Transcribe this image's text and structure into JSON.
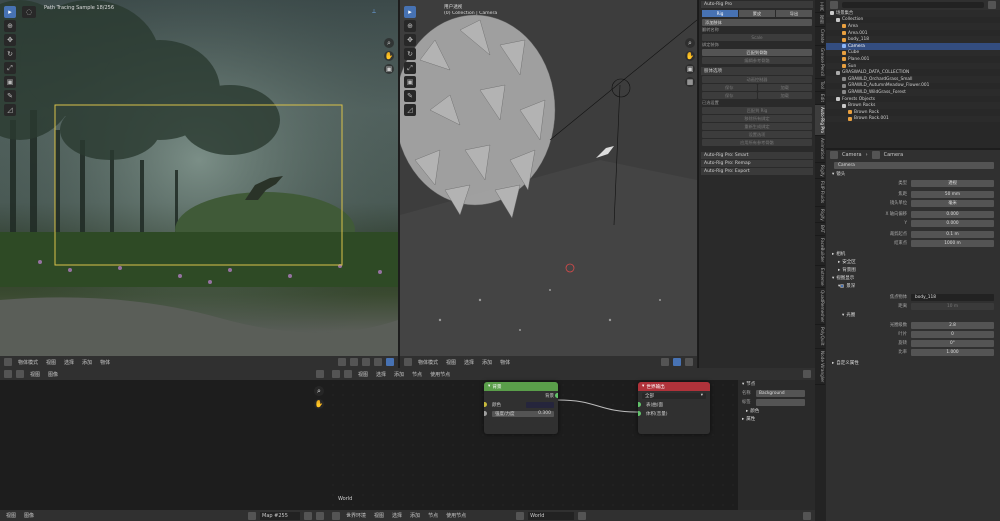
{
  "left_viewport": {
    "title": "Path Tracing Sample 18/256",
    "header": [
      "物体模式",
      "视图",
      "选择",
      "添加",
      "物体"
    ]
  },
  "right_viewport": {
    "title_line1": "用户透视",
    "title_line2": "(0) Collection | Camera",
    "header": [
      "物体模式",
      "视图",
      "选择",
      "添加",
      "物体"
    ]
  },
  "npanel": {
    "title": "Auto-Rig Pro",
    "tabs": [
      "Rig",
      "蒙皮",
      "导出"
    ],
    "add_limb": "添加肢体",
    "rows_top": [
      "翻转名称",
      "Scale"
    ],
    "label_rig_type": "绑定装饰",
    "btn_ref_bones": "匹配到骨骼",
    "btn_edit_ref": "编辑参考骨骼",
    "section_limb": "肢体选项",
    "sect2": "动画控制器",
    "sect3": "已选设置",
    "btns_mid": [
      "保存",
      "加载",
      "保存",
      "加载",
      "匹配到 Rig"
    ],
    "btns_low": [
      "移除所有绑定",
      "重新生成绑定",
      "设置选项",
      "应用所有参考骨骼"
    ],
    "subpanels": [
      "Auto-Rig Pro: Smart",
      "Auto-Rig Pro: Remap",
      "Auto-Rig Pro: Export"
    ]
  },
  "vtabs": [
    "工具",
    "视图",
    "Create",
    "Grease Pencil",
    "Tool",
    "Edit",
    "Auto-Rig Pro",
    "Animation",
    "Rigify",
    "FLIP Fluids",
    "Rigify",
    "BAT",
    "FaceBuilder",
    "Extreme",
    "QuadRemesher",
    "PolyQuilt",
    "Node Wrangler"
  ],
  "outliner": {
    "title": "场景集合",
    "rows": [
      {
        "name": "Collection",
        "indent": 1,
        "color": "#c8c8c8"
      },
      {
        "name": "Area",
        "indent": 2,
        "color": "#e8a040"
      },
      {
        "name": "Area.001",
        "indent": 2,
        "color": "#e8a040"
      },
      {
        "name": "body_118",
        "indent": 2,
        "color": "#e8a040"
      },
      {
        "name": "Camera",
        "indent": 2,
        "color": "#8ab4f8",
        "selected": true
      },
      {
        "name": "Cube",
        "indent": 2,
        "color": "#e8a040"
      },
      {
        "name": "Plane.001",
        "indent": 2,
        "color": "#e8a040"
      },
      {
        "name": "Sun",
        "indent": 2,
        "color": "#e8a040"
      },
      {
        "name": "GRASWALD_DATA_COLLECTION",
        "indent": 1,
        "color": "#aaaaaa"
      },
      {
        "name": "GRAWLD_OrchardGrass_Small",
        "indent": 2,
        "color": "#888888"
      },
      {
        "name": "GRAWLD_AutumnMeadow_Flower.001",
        "indent": 2,
        "color": "#888888"
      },
      {
        "name": "GRAWLD_WildGrass_Forest",
        "indent": 2,
        "color": "#888888"
      },
      {
        "name": "Forests Objects",
        "indent": 1,
        "color": "#c8c8c8"
      },
      {
        "name": "Brown Rocks",
        "indent": 2,
        "color": "#c8c8c8"
      },
      {
        "name": "Brown Rock",
        "indent": 3,
        "color": "#e8a040"
      },
      {
        "name": "Brown Rock.001",
        "indent": 3,
        "color": "#e8a040"
      }
    ]
  },
  "properties": {
    "breadcrumb": [
      "Camera",
      "Camera"
    ],
    "data_name": "Camera",
    "section_lens": "镜头",
    "type_label": "类型",
    "type_value": "透视",
    "focal_label": "焦距",
    "focal_value": "50 mm",
    "units_label": "镜头单位",
    "units_value": "毫米",
    "shiftx_label": "X 轴向偏移",
    "shiftx_value": "0.000",
    "shifty_label": "Y",
    "shifty_value": "0.000",
    "clip_start_label": "裁剪起点",
    "clip_start_value": "0.1 m",
    "clip_end_label": "结束点",
    "clip_end_value": "1000 m",
    "section_camera": "相机",
    "sub_safe": "安全区",
    "sub_bg": "背景图",
    "section_vp": "视图显示",
    "dof_label": "景深",
    "focus_obj_label": "焦点物体",
    "focus_obj_value": "body_118",
    "distance_label": "距离",
    "distance_value": "10 m",
    "aperture_label": "光圈",
    "fstop_label": "光圈级数",
    "fstop_value": "2.8",
    "blades_label": "叶片",
    "blades_value": "0",
    "rotation_label": "旋转",
    "rotation_value": "0°",
    "ratio_label": "比率",
    "ratio_value": "1.000",
    "custom_props": "自定义属性"
  },
  "node_editor": {
    "header": [
      "视图",
      "选择",
      "添加",
      "节点",
      "使用节点"
    ],
    "world_label": "World",
    "node_background": {
      "title": "背景",
      "out_label": "背景",
      "color_label": "颜色",
      "strength_label": "强度/力度",
      "strength_value": "0.300",
      "header_color": "#5a9e4a"
    },
    "node_output": {
      "title": "世界输出",
      "target": "全部",
      "in_surface": "表(曲)面",
      "in_volume": "体积(音量)",
      "header_color": "#b0323a"
    },
    "sidebar": {
      "section": "节点",
      "name_label": "名称",
      "name_value": "Background",
      "label_label": "标签",
      "color_label": "颜色",
      "props": "属性"
    }
  },
  "left_editor": {
    "header": [
      "视图",
      "图像"
    ],
    "image_name": "Map #255"
  },
  "statusbar": {
    "left": [
      "视图",
      "图像"
    ],
    "image": "Map #255",
    "world": "世界环境",
    "world_name": "World"
  }
}
